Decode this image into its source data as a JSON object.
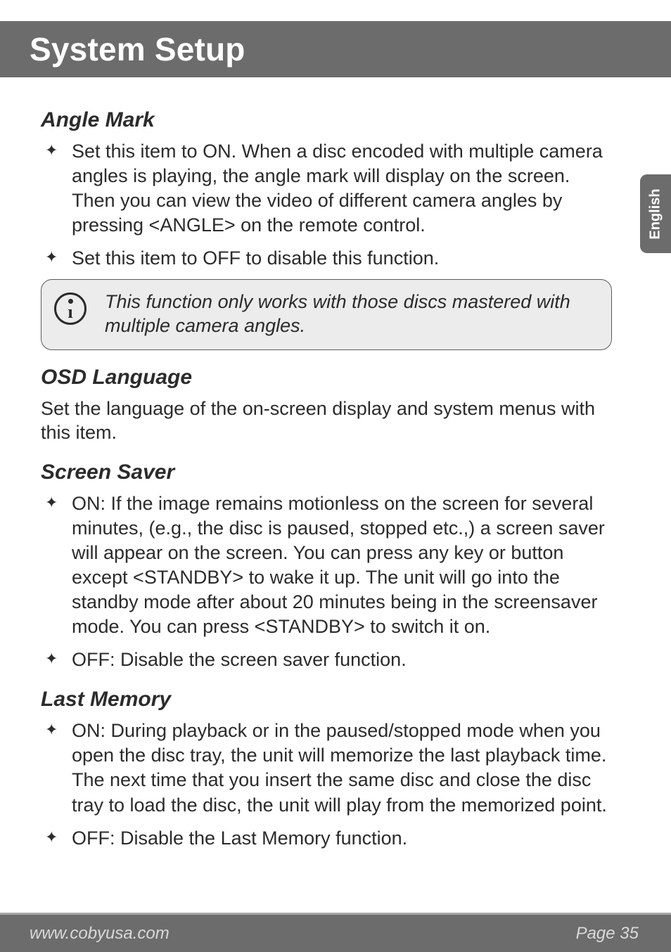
{
  "header": {
    "title": "System Setup"
  },
  "lang_tab": "English",
  "sections": {
    "angle_mark": {
      "heading": "Angle Mark",
      "bullets": [
        "Set this item to ON. When a disc encoded with multiple camera angles is playing, the angle mark will display on the screen. Then you can view the video of different camera angles by pressing <ANGLE> on the remote control.",
        "Set this item to OFF to disable this function."
      ],
      "note": "This function only works with those discs mastered with multiple camera angles."
    },
    "osd_language": {
      "heading": "OSD Language",
      "body": "Set the language of the on-screen display and system menus with this item."
    },
    "screen_saver": {
      "heading": "Screen Saver",
      "bullets": [
        "ON: If the image remains motionless on the screen for several minutes, (e.g., the disc is paused, stopped etc.,) a screen saver will appear on the screen. You can press any key or button except <STANDBY> to wake it up. The unit will go into the standby mode after about 20 minutes being in the screensaver mode. You can press <STANDBY> to switch it on.",
        "OFF: Disable the screen saver function."
      ]
    },
    "last_memory": {
      "heading": "Last Memory",
      "bullets": [
        "ON: During playback or in the paused/stopped mode when you open the disc tray, the unit will memorize the last playback time. The next time that you insert the same disc and close the disc tray to load the disc, the unit will play from the memorized point.",
        "OFF: Disable the Last Memory function."
      ]
    }
  },
  "footer": {
    "url": "www.cobyusa.com",
    "page_label": "Page 35"
  }
}
